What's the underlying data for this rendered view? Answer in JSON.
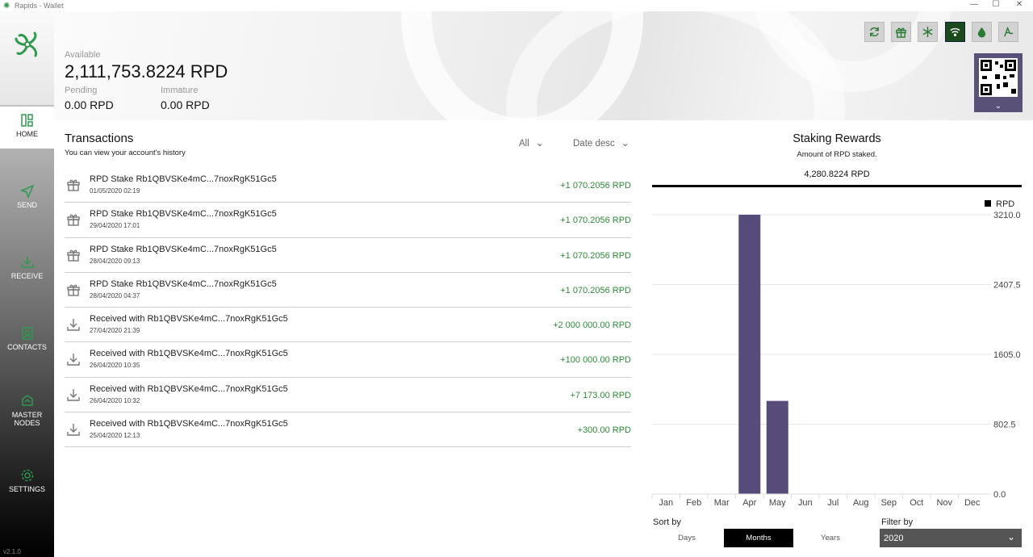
{
  "window": {
    "title": "Rapids - Wallet",
    "minimize": "—",
    "maximize": "☐",
    "close": "✕"
  },
  "sidebar": {
    "items": [
      {
        "label": "HOME",
        "icon": "home-icon"
      },
      {
        "label": "SEND",
        "icon": "send-icon"
      },
      {
        "label": "RECEIVE",
        "icon": "receive-icon"
      },
      {
        "label": "CONTACTS",
        "icon": "contacts-icon"
      },
      {
        "label": "MASTER NODES",
        "icon": "masternodes-icon"
      },
      {
        "label": "SETTINGS",
        "icon": "settings-icon"
      }
    ],
    "version": "v2.1.0"
  },
  "balance": {
    "available_label": "Available",
    "available": "2,111,753.8224 RPD",
    "pending_label": "Pending",
    "pending": "0.00 RPD",
    "immature_label": "Immature",
    "immature": "0.00 RPD"
  },
  "toolbar": {
    "icons": [
      "sync-icon",
      "gift-icon",
      "snowflake-icon",
      "wifi-icon",
      "drop-icon",
      "tor-icon"
    ]
  },
  "transactions": {
    "title": "Transactions",
    "subtitle": "You can view your account's history",
    "filter_type": "All",
    "filter_sort": "Date desc",
    "rows": [
      {
        "icon": "gift-icon",
        "name": "RPD Stake Rb1QBVSKe4mC...7noxRgK51Gc5",
        "date": "01/05/2020 02:19",
        "amount": "+1 070.2056 RPD"
      },
      {
        "icon": "gift-icon",
        "name": "RPD Stake Rb1QBVSKe4mC...7noxRgK51Gc5",
        "date": "29/04/2020 17:01",
        "amount": "+1 070.2056 RPD"
      },
      {
        "icon": "gift-icon",
        "name": "RPD Stake Rb1QBVSKe4mC...7noxRgK51Gc5",
        "date": "28/04/2020 09:13",
        "amount": "+1 070.2056 RPD"
      },
      {
        "icon": "gift-icon",
        "name": "RPD Stake Rb1QBVSKe4mC...7noxRgK51Gc5",
        "date": "28/04/2020 04:37",
        "amount": "+1 070.2056 RPD"
      },
      {
        "icon": "download-icon",
        "name": "Received with Rb1QBVSKe4mC...7noxRgK51Gc5",
        "date": "27/04/2020 21:39",
        "amount": "+2 000 000.00 RPD"
      },
      {
        "icon": "download-icon",
        "name": "Received with Rb1QBVSKe4mC...7noxRgK51Gc5",
        "date": "26/04/2020 10:35",
        "amount": "+100 000.00 RPD"
      },
      {
        "icon": "download-icon",
        "name": "Received with Rb1QBVSKe4mC...7noxRgK51Gc5",
        "date": "26/04/2020 10:32",
        "amount": "+7 173.00 RPD"
      },
      {
        "icon": "download-icon",
        "name": "Received with Rb1QBVSKe4mC...7noxRgK51Gc5",
        "date": "25/04/2020 12:13",
        "amount": "+300.00 RPD"
      }
    ]
  },
  "staking": {
    "title": "Staking Rewards",
    "subtitle": "Amount of RPD staked.",
    "total": "4,280.8224 RPD",
    "sort_label": "Sort by",
    "sort_options": [
      "Days",
      "Months",
      "Years"
    ],
    "sort_selected": "Months",
    "filter_label": "Filter by",
    "filter_value": "2020"
  },
  "chart_data": {
    "type": "bar",
    "categories": [
      "Jan",
      "Feb",
      "Mar",
      "Apr",
      "May",
      "Jun",
      "Jul",
      "Aug",
      "Sep",
      "Oct",
      "Nov",
      "Dec"
    ],
    "series": [
      {
        "name": "RPD",
        "values": [
          0,
          0,
          0,
          3210.6,
          1070.2,
          0,
          0,
          0,
          0,
          0,
          0,
          0
        ]
      }
    ],
    "yticks": [
      "3210.0",
      "2407.5",
      "1605.0",
      "802.5",
      "0.0"
    ],
    "ylim": [
      0,
      3210
    ],
    "bar_color": "#574b7a",
    "legend_position": "top-right",
    "grid": true
  }
}
